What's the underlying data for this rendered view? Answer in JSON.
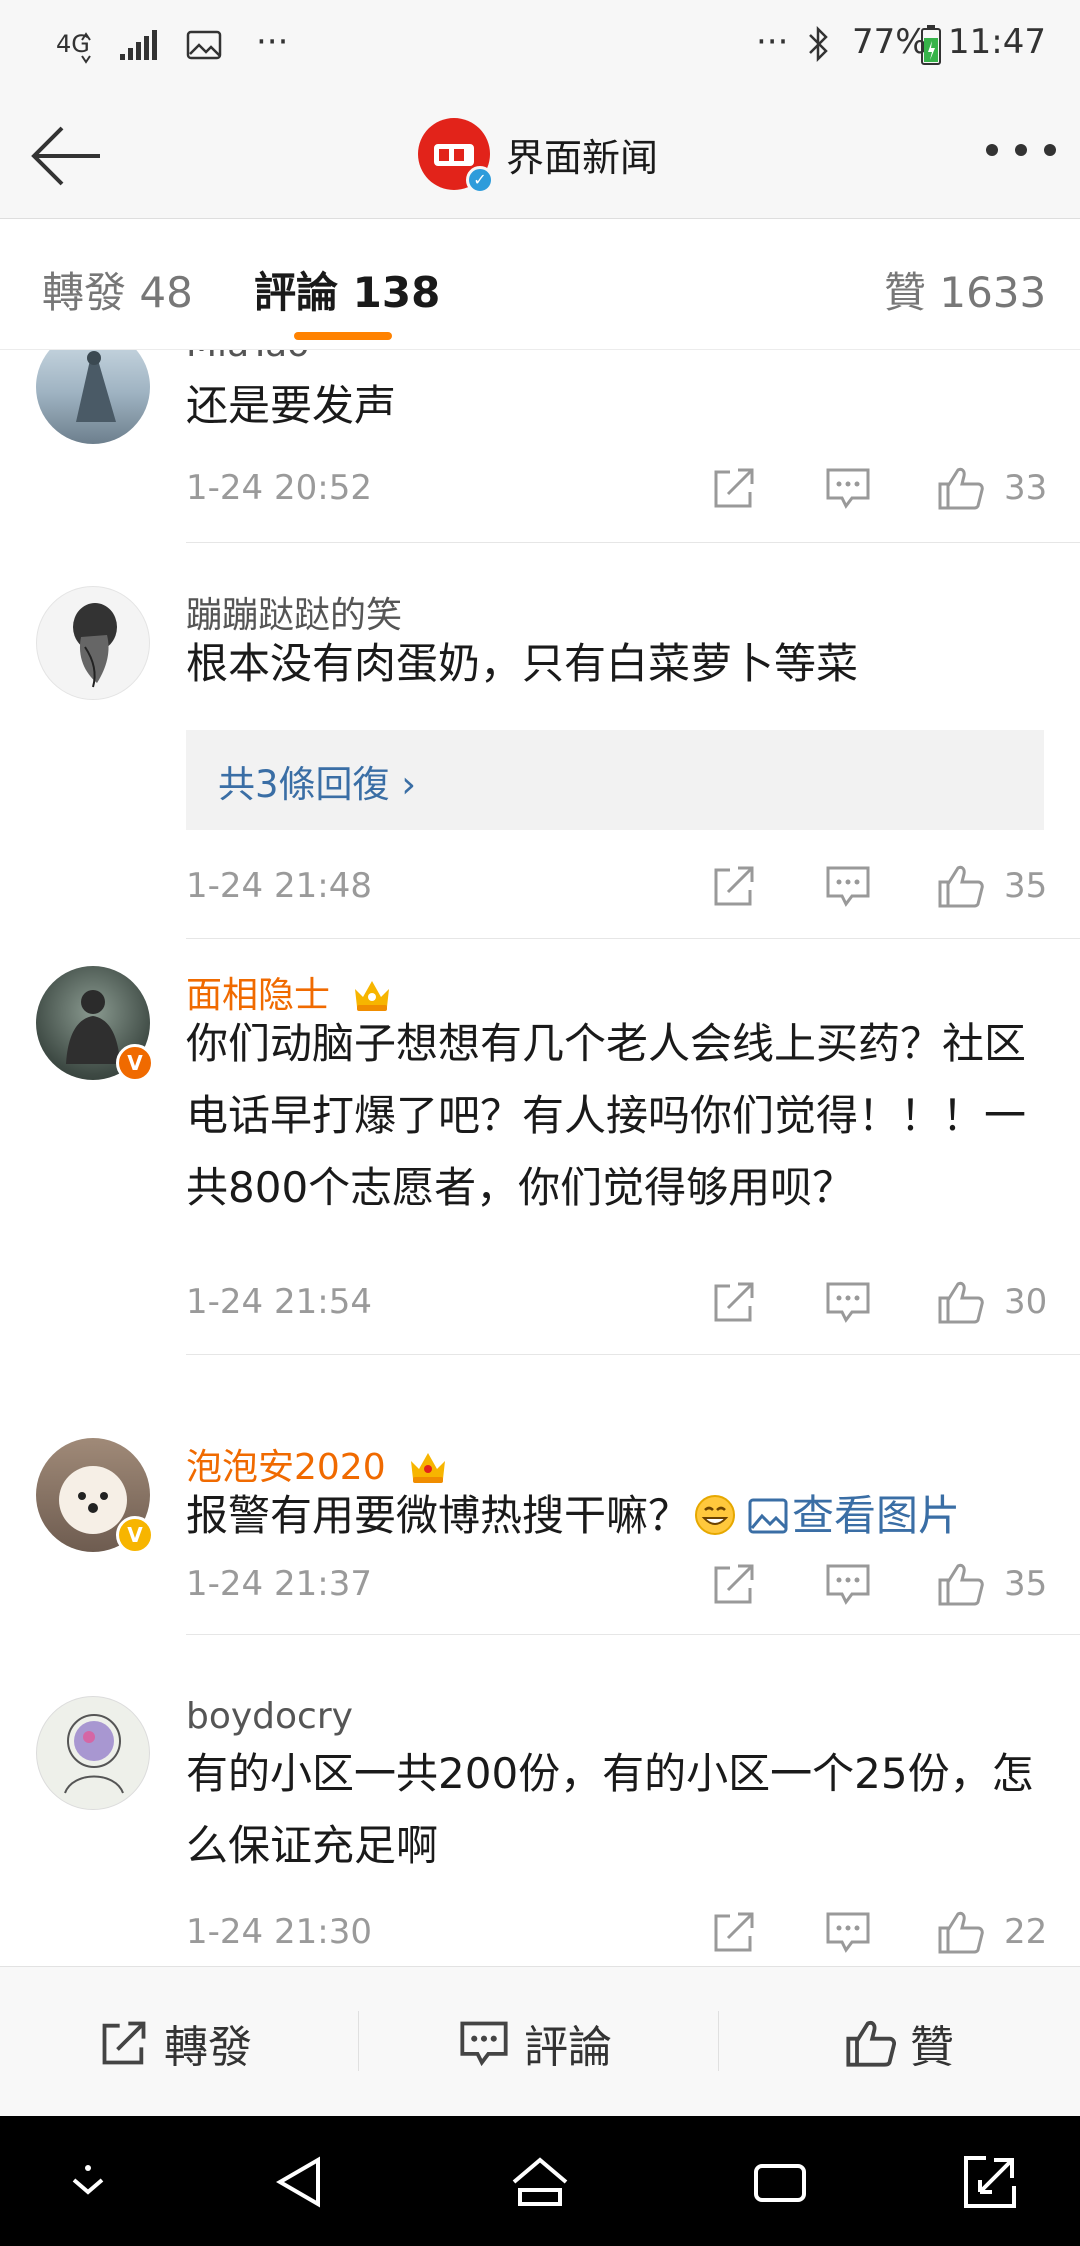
{
  "status_bar": {
    "network": "4G",
    "more_left": "···",
    "more_right": "···",
    "battery": "77%",
    "time": "11:47"
  },
  "nav": {
    "title": "界面新闻",
    "brand_color": "#e2231a"
  },
  "tabs": [
    {
      "label": "轉發 48",
      "active": false
    },
    {
      "label": "評論 138",
      "active": true
    },
    {
      "label": "贊 1633",
      "active": false
    }
  ],
  "colors": {
    "accent": "#ff8200",
    "link": "#3a6ea5",
    "member_name": "#f06a00"
  },
  "comments": [
    {
      "username": "MiaTao",
      "text": "还是要发声",
      "time": "1-24 20:52",
      "likes": "33"
    },
    {
      "username": "蹦蹦跶跶的笑",
      "text": "根本没有肉蛋奶，只有白菜萝卜等菜",
      "replies": "共3條回復 ›",
      "time": "1-24 21:48",
      "likes": "35"
    },
    {
      "username": "面相隐士",
      "badge": "crown-icon",
      "text": "你们动脑子想想有几个老人会线上买药？社区电话早打爆了吧？有人接吗你们觉得！！！一共800个志愿者，你们觉得够用呗？",
      "time": "1-24 21:54",
      "likes": "30"
    },
    {
      "username": "泡泡安2020",
      "badge": "crown-icon",
      "text": "报警有用要微博热搜干嘛？",
      "view_image": "查看图片",
      "time": "1-24 21:37",
      "likes": "35"
    },
    {
      "username": "boydocry",
      "text": "有的小区一共200份，有的小区一个25份，怎么保证充足啊",
      "time": "1-24 21:30",
      "likes": "22"
    }
  ],
  "toolbar": {
    "repost": "轉發",
    "comment": "評論",
    "like": "贊"
  }
}
